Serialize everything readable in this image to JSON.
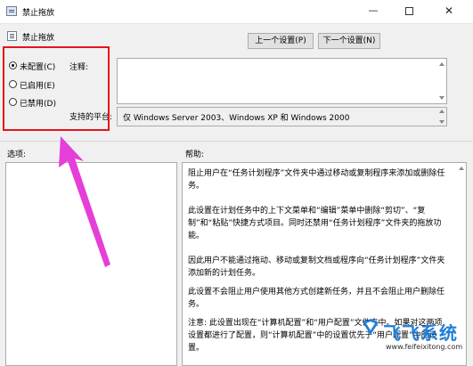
{
  "window": {
    "title": "禁止拖放"
  },
  "header": {
    "policy_name": "禁止拖放",
    "prev_button": "上一个设置(P)",
    "next_button": "下一个设置(N)"
  },
  "state": {
    "options": [
      {
        "label": "未配置(C)",
        "selected": true
      },
      {
        "label": "已启用(E)",
        "selected": false
      },
      {
        "label": "已禁用(D)",
        "selected": false
      }
    ]
  },
  "fields": {
    "comment_label": "注释:",
    "comment_value": "",
    "supported_label": "支持的平台:",
    "supported_value": "仅 Windows Server 2003、Windows XP 和 Windows 2000"
  },
  "panels": {
    "options_label": "选项:",
    "help_label": "帮助:",
    "help_paragraphs": [
      "阻止用户在“任务计划程序”文件夹中通过移动或复制程序来添加或删除任务。",
      "此设置在计划任务中的上下文菜单和“编辑”菜单中删除“剪切”、“复制”和“粘贴”快捷方式项目。同时还禁用“任务计划程序”文件夹的拖放功能。",
      "因此用户不能通过拖动、移动或复制文档或程序向“任务计划程序”文件夹添加新的计划任务。",
      "此设置不会阻止用户使用其他方式创建新任务，并且不会阻止用户删除任务。",
      "注意: 此设置出现在“计算机配置”和“用户配置”文件夹中。如果对这两项设置都进行了配置，则“计算机配置”中的设置优先于“用户配置”中的设置。"
    ]
  },
  "watermark": {
    "text": "飞飞系统",
    "url": "www.feifeixitong.com"
  },
  "colors": {
    "highlight": "#e5141b",
    "arrow": "#e43fd8",
    "watermark": "#1f7fd8"
  }
}
